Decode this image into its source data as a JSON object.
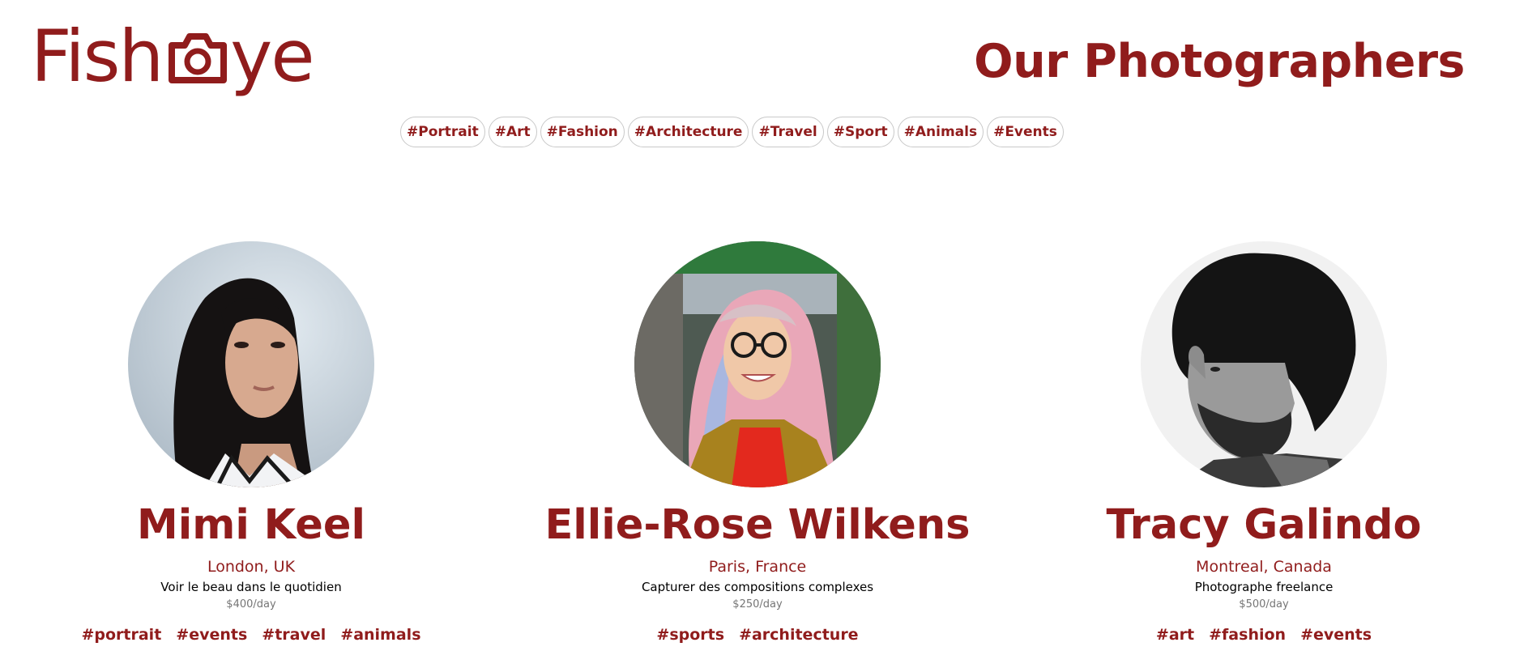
{
  "brand": {
    "logo_text_before": "Fish",
    "logo_text_after": "ye",
    "logo_icon": "camera-icon",
    "color": "#901c1c"
  },
  "header": {
    "title": "Our Photographers"
  },
  "nav": {
    "tags": [
      "#Portrait",
      "#Art",
      "#Fashion",
      "#Architecture",
      "#Travel",
      "#Sport",
      "#Animals",
      "#Events"
    ]
  },
  "photographers": [
    {
      "name": "Mimi Keel",
      "location": "London, UK",
      "tagline": "Voir le beau dans le quotidien",
      "price": "$400/day",
      "tags": [
        "#portrait",
        "#events",
        "#travel",
        "#animals"
      ]
    },
    {
      "name": "Ellie-Rose Wilkens",
      "location": "Paris, France",
      "tagline": "Capturer des compositions complexes",
      "price": "$250/day",
      "tags": [
        "#sports",
        "#architecture"
      ]
    },
    {
      "name": "Tracy Galindo",
      "location": "Montreal, Canada",
      "tagline": "Photographe freelance",
      "price": "$500/day",
      "tags": [
        "#art",
        "#fashion",
        "#events"
      ]
    }
  ],
  "colors": {
    "accent": "#901c1c",
    "price": "#757575",
    "tag_border": "#c9c9c9"
  }
}
